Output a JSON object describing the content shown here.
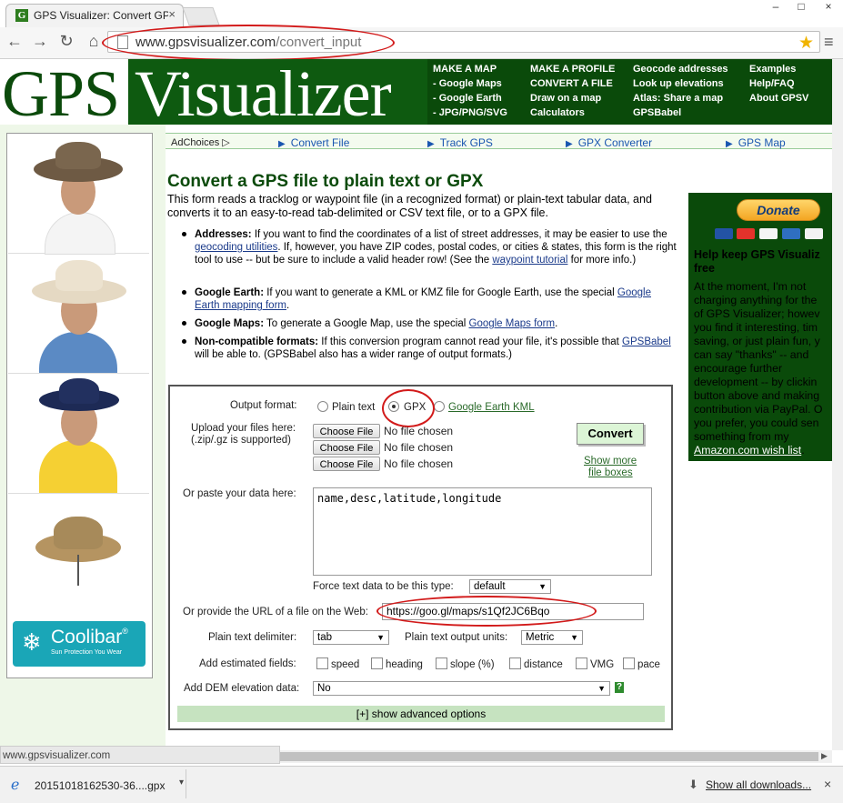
{
  "browser": {
    "tab_title": "GPS Visualizer: Convert GP",
    "tab_close": "×",
    "window_controls": [
      "–",
      "□",
      "×"
    ],
    "nav": {
      "back": "←",
      "forward": "→",
      "reload": "↻",
      "home": "⌂"
    },
    "url_host": "www.gpsvisualizer.com",
    "url_path": "/convert_input",
    "star": "★",
    "menu": "≡"
  },
  "site": {
    "logo_left": "GPS",
    "logo_right": "Visualizer",
    "nav_cols": [
      [
        "MAKE A MAP",
        "- Google Maps",
        "- Google Earth",
        "- JPG/PNG/SVG"
      ],
      [
        "MAKE A PROFILE",
        "CONVERT A FILE",
        "Draw on a map",
        "Calculators"
      ],
      [
        "Geocode addresses",
        "Look up elevations",
        "Atlas: Share a map",
        "GPSBabel"
      ],
      [
        "Examples",
        "Help/FAQ",
        "About GPSV"
      ]
    ]
  },
  "adbar": {
    "adchoices": "AdChoices ▷",
    "links": [
      "Convert File",
      "Track GPS",
      "GPX Converter",
      "GPS Map"
    ]
  },
  "ad": {
    "adchoices_icon": "▷✕",
    "brand": "Coolibar",
    "trademark": "®",
    "tagline": "Sun Protection You Wear"
  },
  "page": {
    "title": "Convert a GPS file to plain text or GPX",
    "intro": "This form reads a tracklog or waypoint file (in a recognized format) or plain-text tabular data, and converts it to an easy-to-read tab-delimited or CSV text file, or to a GPX file.",
    "bullets": [
      {
        "head": "Addresses:",
        "t1": " If you want to find the coordinates of a list of street addresses, it may be easier to use the ",
        "l1": "geocoding utilities",
        "t2": ". If, however, you have ZIP codes, postal codes, or cities & states, this form is the right tool to use -- but be sure to include a valid header row! (See the ",
        "l2": "waypoint tutorial",
        "t3": " for more info.)"
      },
      {
        "head": "Google Earth:",
        "t1": " If you want to generate a KML or KMZ file for Google Earth, use the special ",
        "l1": "Google Earth mapping form",
        "t2": ".",
        "l2": "",
        "t3": ""
      },
      {
        "head": "Google Maps:",
        "t1": " To generate a Google Map, use the special ",
        "l1": "Google Maps form",
        "t2": ".",
        "l2": "",
        "t3": ""
      },
      {
        "head": "Non-compatible formats:",
        "t1": " If this conversion program cannot read your file, it's possible that ",
        "l1": "GPSBabel",
        "t2": " will be able to. (GPSBabel also has a wider range of output formats.)",
        "l2": "",
        "t3": ""
      }
    ]
  },
  "donate": {
    "button": "Donate",
    "heading": "Help keep GPS Visualiz free",
    "lines": [
      "At the moment, I'm not",
      "charging anything for the",
      "of GPS Visualizer; howev",
      "you find it interesting, tim",
      "saving, or just plain fun, y",
      "can say \"thanks\" -- and",
      "encourage further",
      "development -- by clickin",
      "button above and making",
      "contribution via PayPal. O",
      "you prefer, you could sen",
      "something from my"
    ],
    "wishlist": "Amazon.com wish list",
    "wishlist_end": "."
  },
  "form": {
    "output_format_label": "Output format:",
    "formats": [
      "Plain text",
      "GPX",
      "Google Earth KML"
    ],
    "selected_format": "GPX",
    "upload_label_1": "Upload your files here:",
    "upload_label_2": "(.zip/.gz is supported)",
    "choose_file": "Choose File",
    "no_file": "No file chosen",
    "convert": "Convert",
    "show_more_1": "Show more",
    "show_more_2": "file boxes",
    "paste_label": "Or paste your data here:",
    "paste_value": "name,desc,latitude,longitude",
    "force_label": "Force text data to be this type:",
    "force_value": "default",
    "url_label": "Or provide the URL of a file on the Web:",
    "url_value": "https://goo.gl/maps/s1Qf2JC6Bqo",
    "delim_label": "Plain text delimiter:",
    "delim_value": "tab",
    "units_label": "Plain text output units:",
    "units_value": "Metric",
    "fields_label": "Add estimated fields:",
    "fields": [
      "speed",
      "heading",
      "slope (%)",
      "distance",
      "VMG",
      "pace"
    ],
    "dem_label": "Add DEM elevation data:",
    "dem_value": "No",
    "dem_help": "?",
    "advanced": "[+] show advanced options"
  },
  "status": {
    "url": "www.gpsvisualizer.com"
  },
  "downloads": {
    "file": "20151018162530-36....gpx",
    "show_all": "Show all downloads...",
    "close": "×"
  },
  "colors": {
    "brand_green": "#0a4a0a",
    "accent_link": "#1a56b0",
    "annotation_red": "#d21a1a"
  }
}
